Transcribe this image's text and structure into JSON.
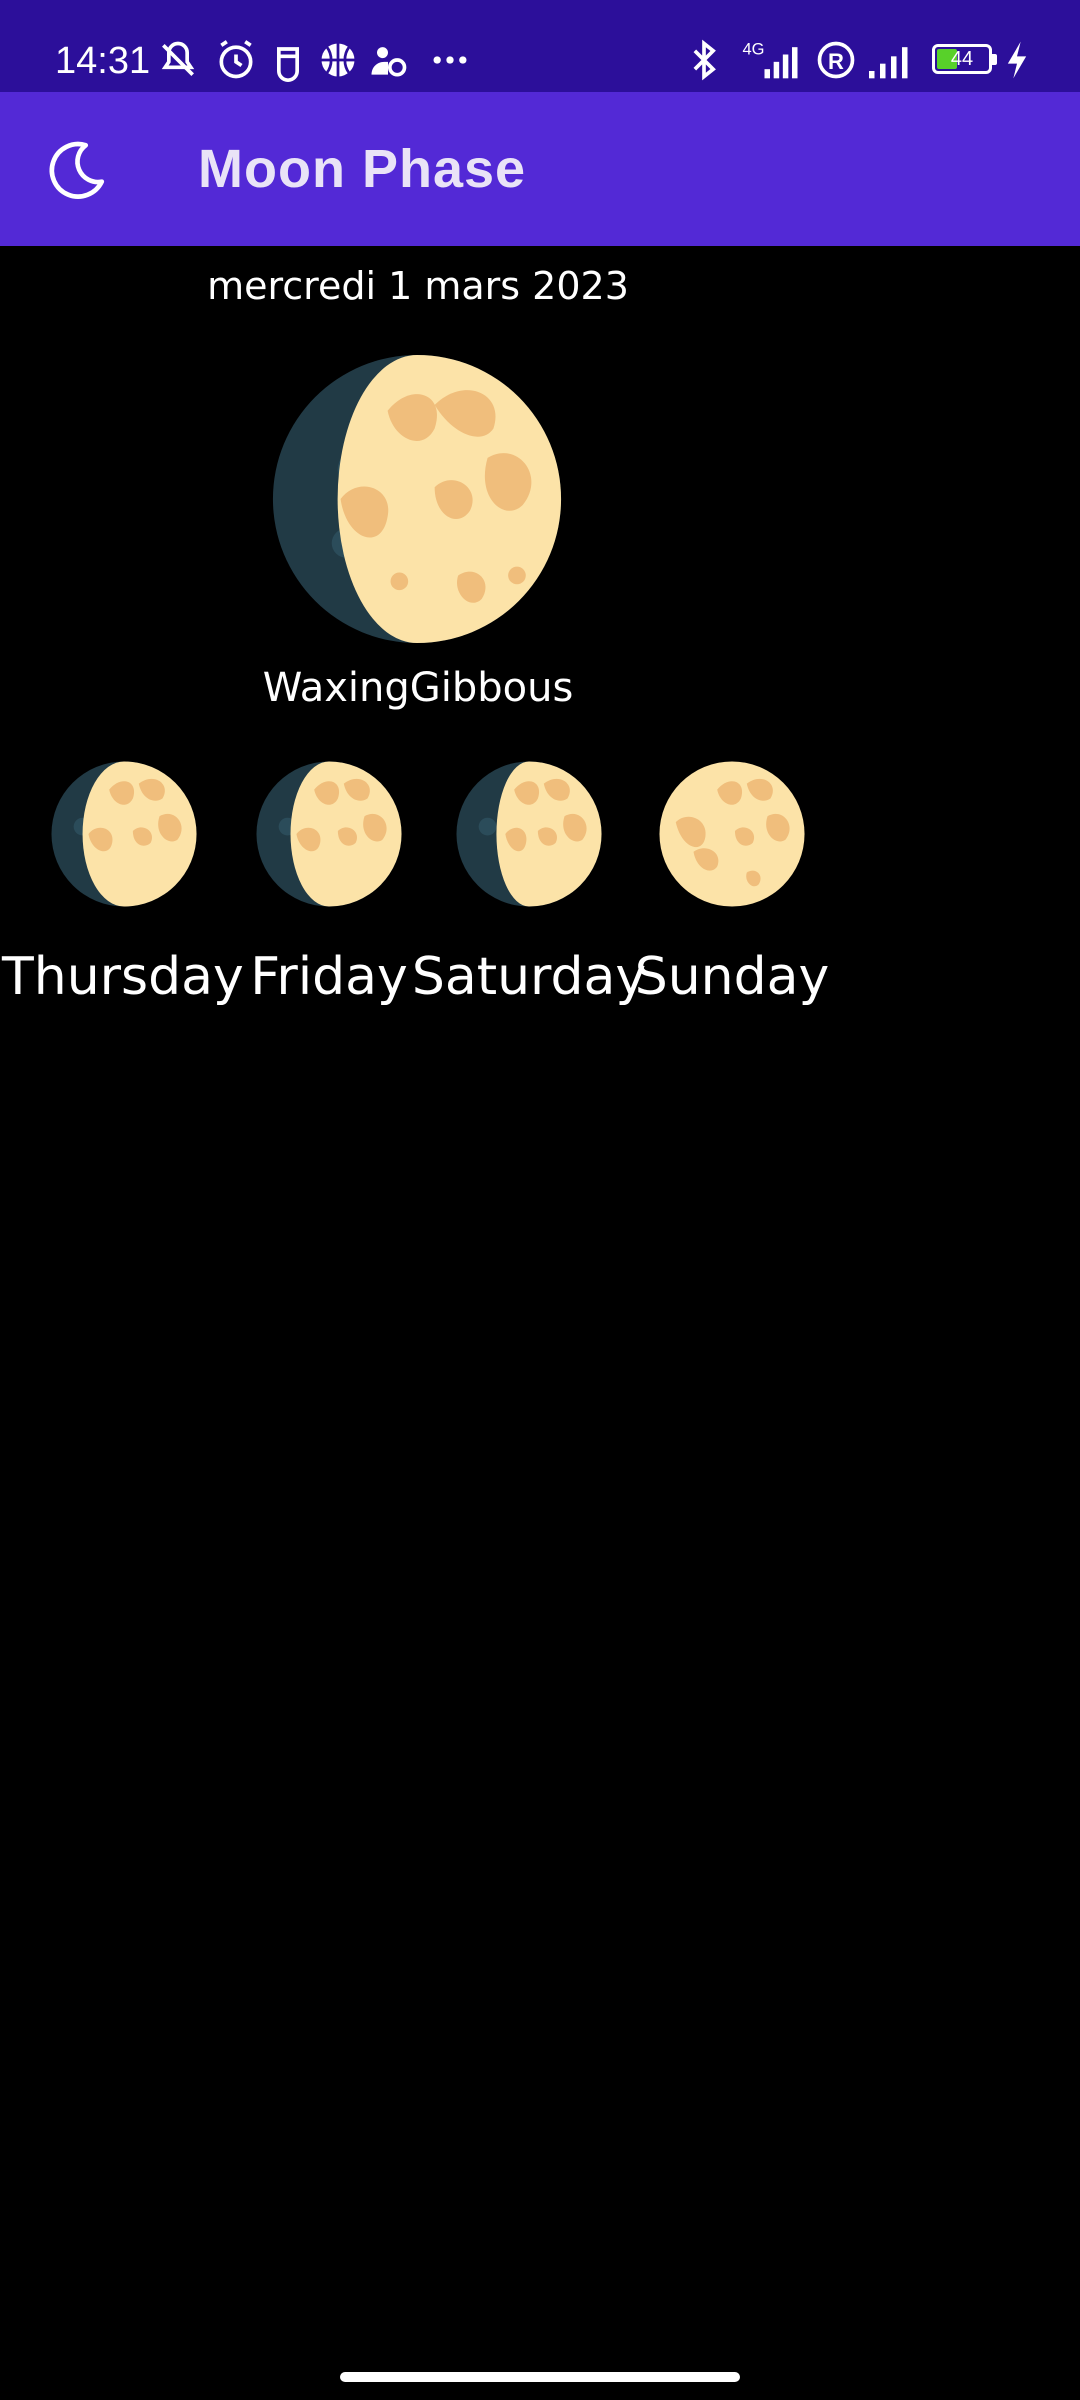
{
  "status_bar": {
    "time": "14:31",
    "network": "4G",
    "battery_level": "44",
    "battery_percent": 44,
    "icons": [
      "muted-notification-icon",
      "alarm-icon",
      "santa-icon",
      "basketball-icon",
      "sleep-icon",
      "more-dots-icon",
      "bluetooth-icon",
      "signal-4g-icon",
      "roaming-icon",
      "signal-icon",
      "battery-icon",
      "charging-icon"
    ]
  },
  "app_bar": {
    "title": "Moon Phase",
    "icon": "moon-crescent-icon",
    "color": "#5329d6"
  },
  "today": {
    "date": "mercredi 1 mars 2023",
    "phase": "WaxingGibbous",
    "icon": "waxing-gibbous-moon-icon"
  },
  "forecast": [
    {
      "day": "Thursday",
      "icon": "waxing-gibbous-moon-icon"
    },
    {
      "day": "Friday",
      "icon": "waxing-gibbous-moon-icon"
    },
    {
      "day": "Saturday",
      "icon": "waxing-gibbous-moon-icon"
    },
    {
      "day": "Sunday",
      "icon": "full-moon-icon"
    }
  ],
  "colors": {
    "status_bar": "#2c0f9a",
    "background": "#000000",
    "moon_light": "#fce3a8",
    "moon_spot": "#f0be7c",
    "moon_dark": "#213a45"
  }
}
